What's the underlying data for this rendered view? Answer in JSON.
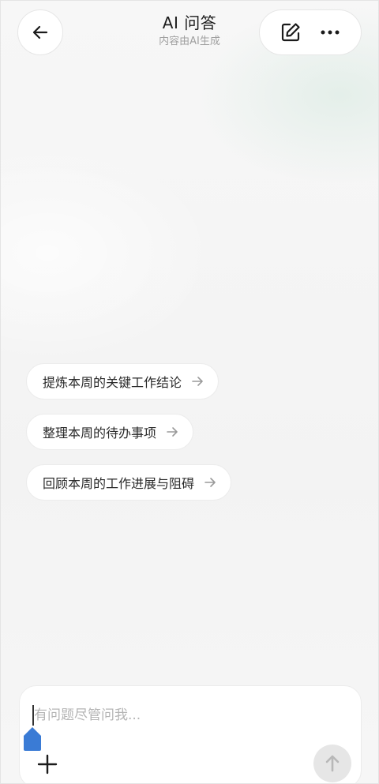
{
  "header": {
    "title": "AI 问答",
    "subtitle": "内容由AI生成",
    "back_icon": "arrow-left-icon",
    "edit_icon": "edit-icon",
    "more_icon": "more-dots-icon"
  },
  "suggestions": [
    {
      "label": "提炼本周的关键工作结论"
    },
    {
      "label": "整理本周的待办事项"
    },
    {
      "label": "回顾本周的工作进展与阻碍"
    }
  ],
  "composer": {
    "placeholder": "有问题尽管问我...",
    "add_icon": "plus-icon",
    "send_icon": "arrow-up-icon"
  },
  "colors": {
    "background": "#f5f5f5",
    "card": "#ffffff",
    "cursor_handle": "#3a7bd5",
    "send_disabled": "#e6e6e6"
  }
}
